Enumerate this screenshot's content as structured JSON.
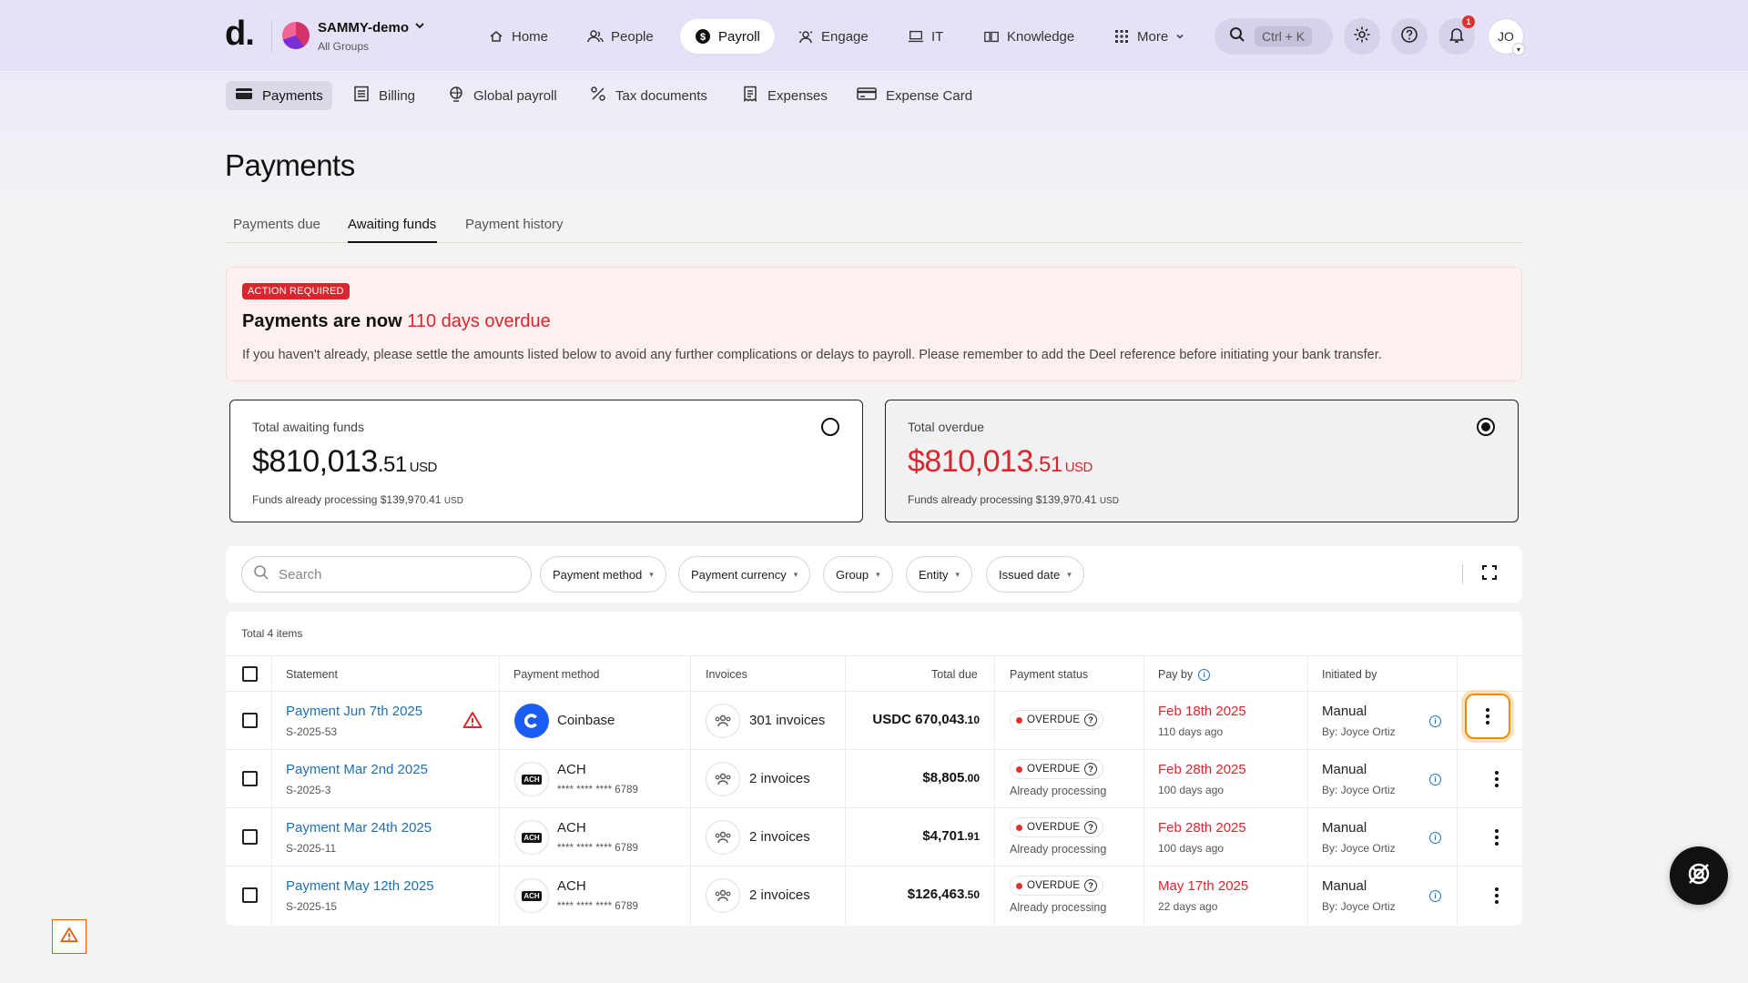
{
  "topbar": {
    "logo": "d.",
    "org_name": "SAMMY-demo",
    "org_sub": "All Groups",
    "nav": [
      {
        "label": "Home",
        "icon": "home-icon"
      },
      {
        "label": "People",
        "icon": "people-icon"
      },
      {
        "label": "Payroll",
        "icon": "dollar-icon",
        "active": true
      },
      {
        "label": "Engage",
        "icon": "engage-icon"
      },
      {
        "label": "IT",
        "icon": "laptop-icon"
      },
      {
        "label": "Knowledge",
        "icon": "book-icon"
      },
      {
        "label": "More",
        "icon": "grid-icon"
      }
    ],
    "search_shortcut": "Ctrl + K",
    "notif_count": "1",
    "user_initials": "JO"
  },
  "subnav": [
    {
      "label": "Payments",
      "active": true
    },
    {
      "label": "Billing"
    },
    {
      "label": "Global payroll"
    },
    {
      "label": "Tax documents"
    },
    {
      "label": "Expenses"
    },
    {
      "label": "Expense Card"
    }
  ],
  "page": {
    "title": "Payments",
    "tabs": [
      "Payments due",
      "Awaiting funds",
      "Payment history"
    ],
    "active_tab": "Awaiting funds"
  },
  "alert": {
    "badge": "ACTION REQUIRED",
    "title_prefix": "Payments are now ",
    "title_highlight": "110 days overdue",
    "body": "If you haven't already, please settle the amounts listed below to avoid any further complications or delays to payroll. Please remember to add the Deel reference before initiating your bank transfer."
  },
  "cards": {
    "awaiting": {
      "label": "Total awaiting funds",
      "amount_main": "$810,013",
      "amount_cents": ".51",
      "currency": "USD",
      "sub": "Funds already processing $139,970.41",
      "sub_currency": "USD",
      "selected": false
    },
    "overdue": {
      "label": "Total overdue",
      "amount_main": "$810,013",
      "amount_cents": ".51",
      "currency": "USD",
      "sub": "Funds already processing $139,970.41",
      "sub_currency": "USD",
      "selected": true
    }
  },
  "filters": {
    "search_placeholder": "Search",
    "chips": [
      "Payment method",
      "Payment currency",
      "Group",
      "Entity",
      "Issued date"
    ]
  },
  "table": {
    "total": "Total 4 items",
    "headers": {
      "statement": "Statement",
      "payment_method": "Payment method",
      "invoices": "Invoices",
      "total_due": "Total due",
      "payment_status": "Payment status",
      "pay_by": "Pay by",
      "initiated_by": "Initiated by"
    },
    "rows": [
      {
        "statement": "Payment Jun 7th 2025",
        "id": "S-2025-53",
        "warning": true,
        "method": "Coinbase",
        "account": "",
        "invoices": "301 invoices",
        "amount_main": "USDC 670,043",
        "amount_cents": ".10",
        "status": "OVERDUE",
        "processing": "",
        "pay_by": "Feb 18th 2025",
        "days_ago": "110 days ago",
        "initiated": "Manual",
        "initiated_by": "By: Joyce Ortiz"
      },
      {
        "statement": "Payment Mar 2nd 2025",
        "id": "S-2025-3",
        "warning": false,
        "method": "ACH",
        "account": "**** **** **** 6789",
        "invoices": "2 invoices",
        "amount_main": "$8,805",
        "amount_cents": ".00",
        "status": "OVERDUE",
        "processing": "Already processing",
        "pay_by": "Feb 28th 2025",
        "days_ago": "100 days ago",
        "initiated": "Manual",
        "initiated_by": "By: Joyce Ortiz"
      },
      {
        "statement": "Payment Mar 24th 2025",
        "id": "S-2025-11",
        "warning": false,
        "method": "ACH",
        "account": "**** **** **** 6789",
        "invoices": "2 invoices",
        "amount_main": "$4,701",
        "amount_cents": ".91",
        "status": "OVERDUE",
        "processing": "Already processing",
        "pay_by": "Feb 28th 2025",
        "days_ago": "100 days ago",
        "initiated": "Manual",
        "initiated_by": "By: Joyce Ortiz"
      },
      {
        "statement": "Payment May 12th 2025",
        "id": "S-2025-15",
        "warning": false,
        "method": "ACH",
        "account": "**** **** **** 6789",
        "invoices": "2 invoices",
        "amount_main": "$126,463",
        "amount_cents": ".50",
        "status": "OVERDUE",
        "processing": "Already processing",
        "pay_by": "May 17th 2025",
        "days_ago": "22 days ago",
        "initiated": "Manual",
        "initiated_by": "By: Joyce Ortiz"
      }
    ]
  },
  "colors": {
    "accent_red": "#d9262e",
    "link_blue": "#1f6fb2",
    "topbar_bg": "#e6e1f7",
    "focus_orange": "#f08c00"
  }
}
